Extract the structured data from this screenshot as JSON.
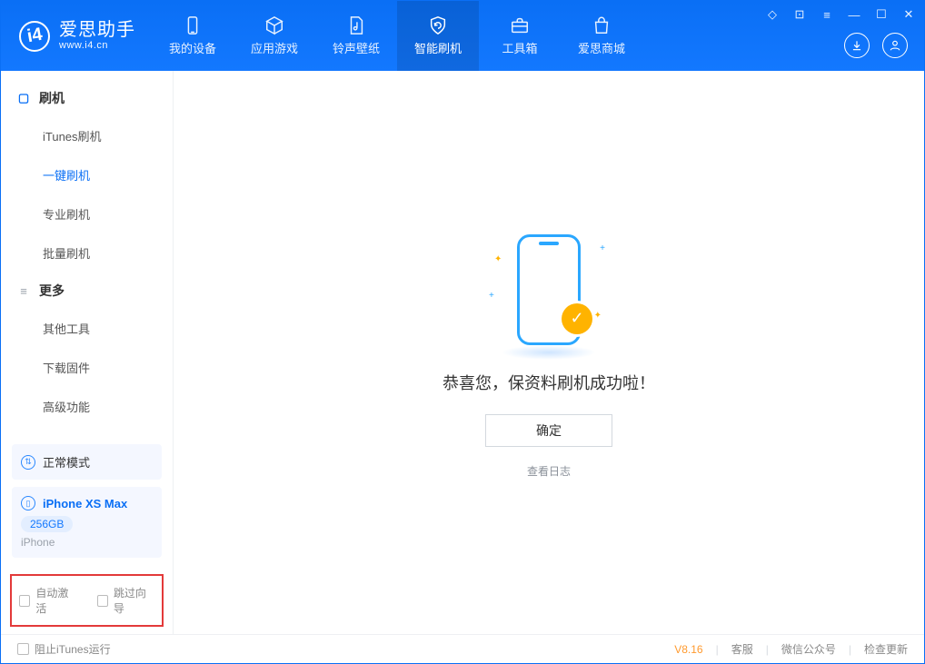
{
  "app": {
    "name": "爱思助手",
    "url": "www.i4.cn"
  },
  "tabs": [
    {
      "label": "我的设备"
    },
    {
      "label": "应用游戏"
    },
    {
      "label": "铃声壁纸"
    },
    {
      "label": "智能刷机"
    },
    {
      "label": "工具箱"
    },
    {
      "label": "爱思商城"
    }
  ],
  "sidebar": {
    "section_flash": "刷机",
    "items_flash": [
      "iTunes刷机",
      "一键刷机",
      "专业刷机",
      "批量刷机"
    ],
    "section_more": "更多",
    "items_more": [
      "其他工具",
      "下载固件",
      "高级功能"
    ]
  },
  "status": {
    "mode": "正常模式",
    "device_name": "iPhone XS Max",
    "capacity": "256GB",
    "device_type": "iPhone"
  },
  "options": {
    "auto_activate": "自动激活",
    "skip_wizard": "跳过向导"
  },
  "result": {
    "success_text": "恭喜您，保资料刷机成功啦！",
    "ok": "确定",
    "view_log": "查看日志"
  },
  "footer": {
    "block_itunes": "阻止iTunes运行",
    "version": "V8.16",
    "support": "客服",
    "wechat": "微信公众号",
    "check_update": "检查更新"
  }
}
